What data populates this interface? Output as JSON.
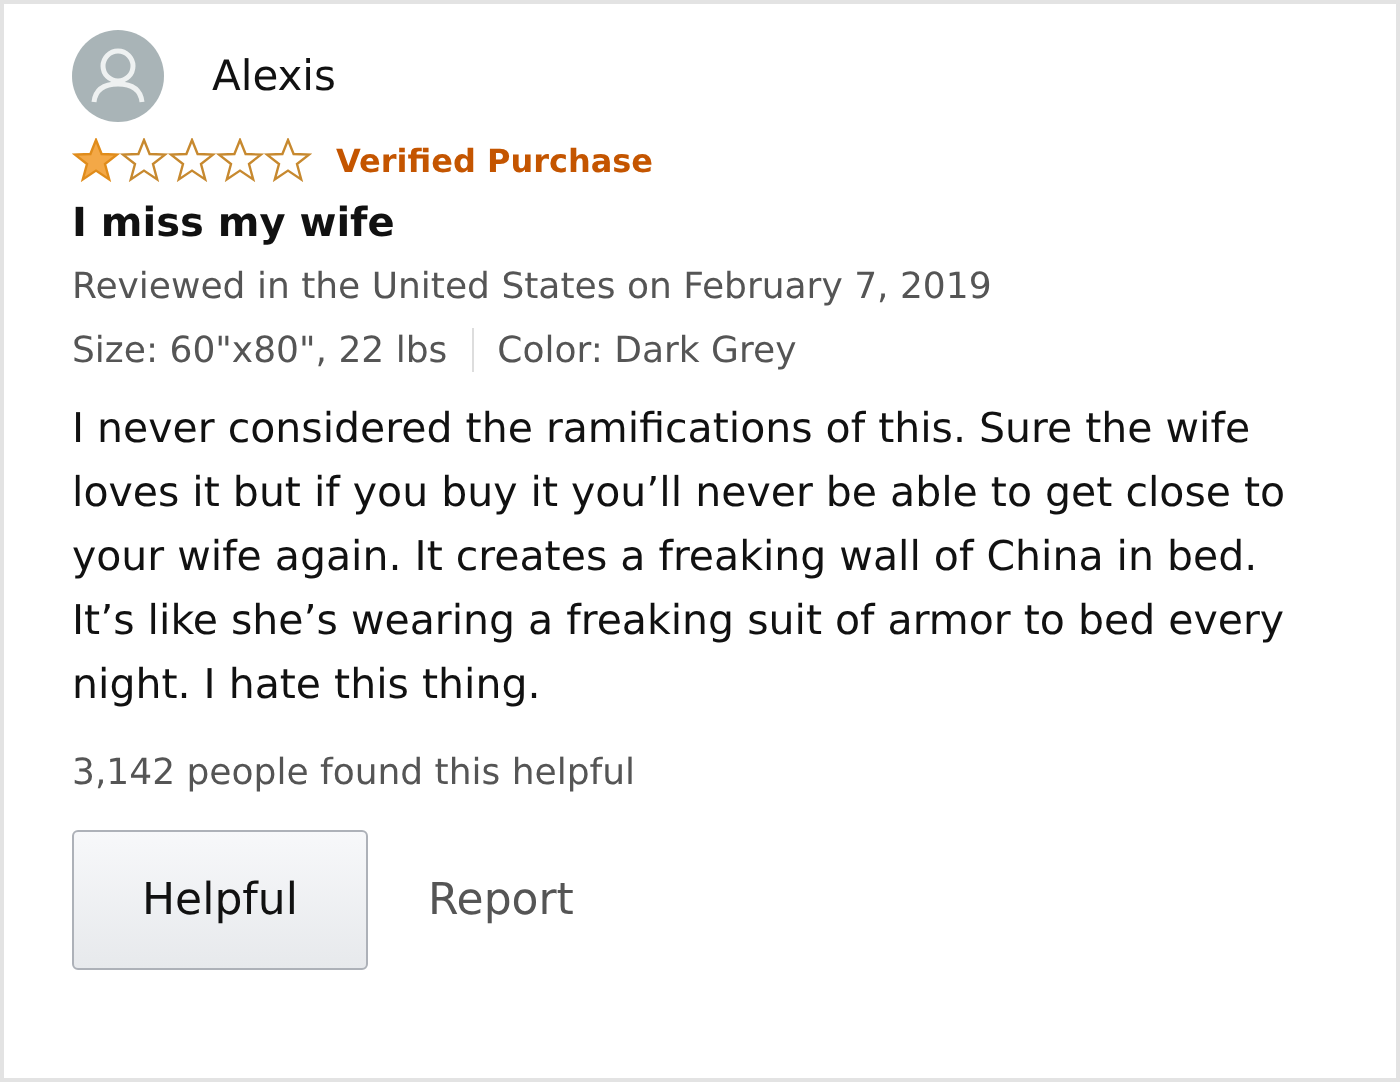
{
  "review": {
    "author": "Alexis",
    "stars": 1,
    "badge": "Verified Purchase",
    "title": "I miss my wife",
    "reviewed": "Reviewed in the United States on February 7, 2019",
    "attributes": [
      "Size: 60\"x80\", 22 lbs",
      "Color: Dark Grey"
    ],
    "body": "I never considered the ramifications of this. Sure the wife loves it but if you buy it you’ll never be able to get close to your wife again. It creates a freaking wall of China in bed. It’s like she’s wearing a freaking suit of armor to bed every night. I hate this thing.",
    "helpful_count": "3,142 people found this helpful",
    "buttons": [
      {
        "kind": "button",
        "label": "Helpful"
      },
      {
        "kind": "link",
        "label": "Report"
      }
    ]
  }
}
